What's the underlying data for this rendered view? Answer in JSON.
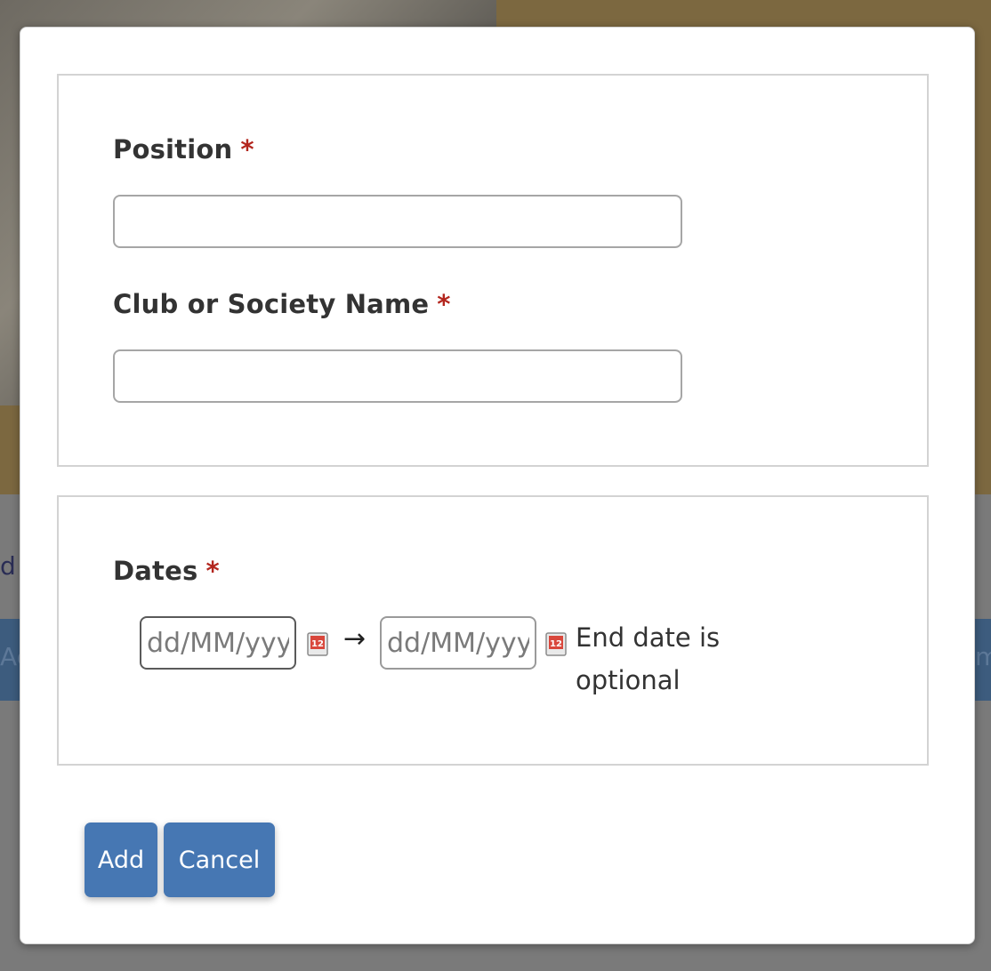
{
  "backdrop": {
    "fragment_left_1": "d",
    "fragment_left_2": "Ac",
    "fragment_right_1": "m"
  },
  "modal": {
    "position": {
      "label": "Position",
      "required_mark": "*",
      "value": ""
    },
    "club": {
      "label": "Club or Society Name",
      "required_mark": "*",
      "value": ""
    },
    "dates": {
      "label": "Dates",
      "required_mark": "*",
      "start_placeholder": "dd/MM/yyyy",
      "end_placeholder": "dd/MM/yyyy",
      "separator": "→",
      "hint": "End date is optional",
      "calendar_icon_badge": "12"
    },
    "buttons": {
      "add": "Add",
      "cancel": "Cancel"
    }
  },
  "colors": {
    "primary_button": "#4677b3",
    "required": "#b3261e",
    "label_text": "#333333"
  },
  "icons": [
    "calendar-icon",
    "right-arrow-icon"
  ]
}
